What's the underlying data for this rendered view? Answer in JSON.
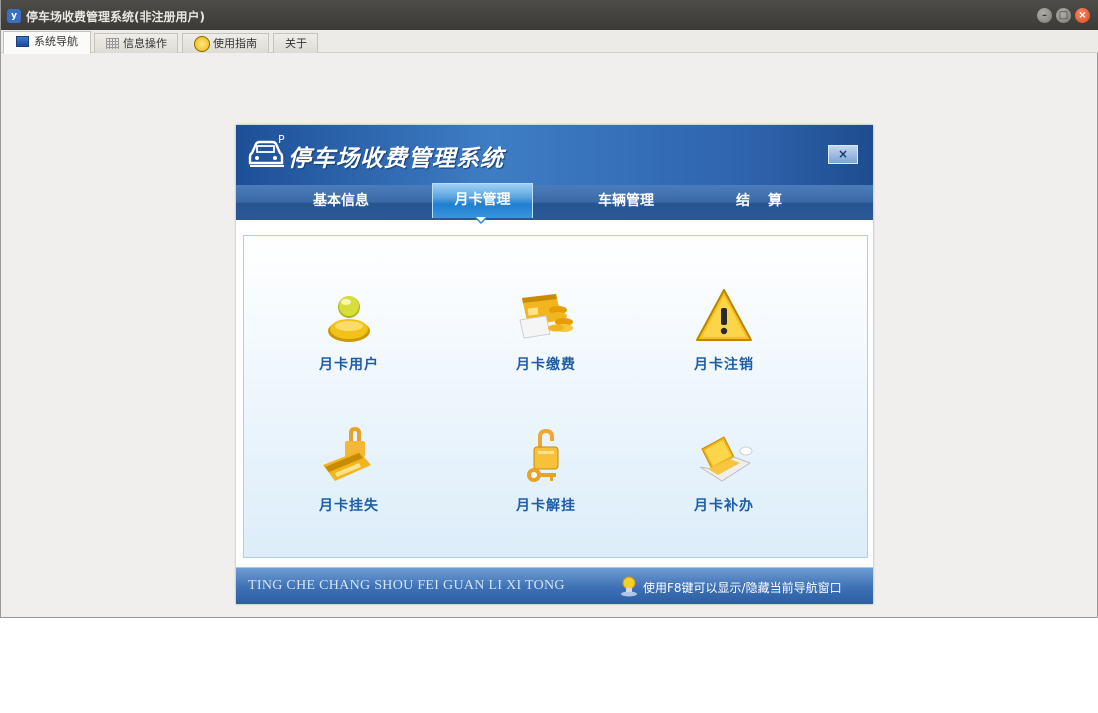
{
  "window": {
    "title": "停车场收费管理系统(非注册用户)",
    "logo_text": "y",
    "controls": {
      "minimize": "–",
      "maximize": "□",
      "close": "×"
    }
  },
  "tabs": [
    {
      "label": "系统导航",
      "icon": "monitor-icon",
      "active": true
    },
    {
      "label": "信息操作",
      "icon": "grid-icon",
      "active": false
    },
    {
      "label": "使用指南",
      "icon": "help-circle-icon",
      "active": false
    },
    {
      "label": "关于",
      "icon": "",
      "active": false
    }
  ],
  "panel": {
    "title": "停车场收费管理系统",
    "close_label": "×",
    "logo_letter": "P"
  },
  "nav": {
    "items": [
      {
        "label": "基本信息",
        "active": false
      },
      {
        "label": "月卡管理",
        "active": true
      },
      {
        "label": "车辆管理",
        "active": false
      },
      {
        "label": "结算",
        "active": false
      }
    ]
  },
  "tiles": [
    {
      "label": "月卡用户",
      "icon": "user-icon"
    },
    {
      "label": "月卡缴费",
      "icon": "card-coins-icon"
    },
    {
      "label": "月卡注销",
      "icon": "warning-icon"
    },
    {
      "label": "月卡挂失",
      "icon": "card-lock-icon"
    },
    {
      "label": "月卡解挂",
      "icon": "lock-key-icon"
    },
    {
      "label": "月卡补办",
      "icon": "laptop-icon"
    }
  ],
  "footer": {
    "left_text": "TING CHE CHANG SHOU FEI  GUAN LI XI TONG",
    "tip_text": "使用F8键可以显示/隐藏当前导航窗口",
    "tip_icon": "lightbulb-icon"
  },
  "colors": {
    "titlebar": "#3c3b37",
    "header_blue": "#2e64ad",
    "tile_label": "#1f5ea6",
    "close_orange": "#e0451a"
  }
}
